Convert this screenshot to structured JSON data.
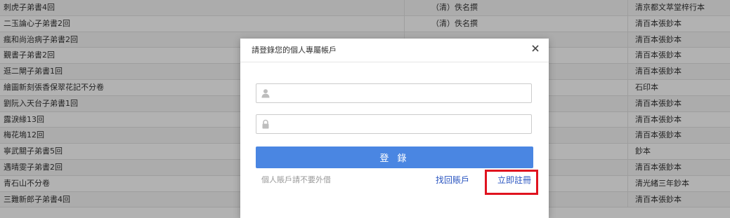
{
  "table": {
    "rows": [
      {
        "title": "刺虎子弟書4回",
        "author": "（清）佚名撰",
        "edition": "清京都文萃堂梓行本"
      },
      {
        "title": "二玉論心子弟書2回",
        "author": "（清）佚名撰",
        "edition": "清百本張鈔本"
      },
      {
        "title": "瘋和尚治病子弟書2回",
        "author": "",
        "edition": "清百本張鈔本"
      },
      {
        "title": "覲書子弟書2回",
        "author": "",
        "edition": "清百本張鈔本"
      },
      {
        "title": "逛二閘子弟書1回",
        "author": "",
        "edition": "清百本張鈔本"
      },
      {
        "title": "繪圖新刻張香保翠花記不分卷",
        "author": "",
        "edition": "石印本"
      },
      {
        "title": "劉阮入天台子弟書1回",
        "author": "",
        "edition": "清百本張鈔本"
      },
      {
        "title": "露淚緣13回",
        "author": "",
        "edition": "清百本張鈔本"
      },
      {
        "title": "梅花塢12回",
        "author": "",
        "edition": "清百本張鈔本"
      },
      {
        "title": "寧武關子弟書5回",
        "author": "",
        "edition": "鈔本"
      },
      {
        "title": "遇晴雯子弟書2回",
        "author": "",
        "edition": "清百本張鈔本"
      },
      {
        "title": "青石山不分卷",
        "author": "",
        "edition": "清光緒三年鈔本"
      },
      {
        "title": "三難新郎子弟書4回",
        "author": "",
        "edition": "清百本張鈔本"
      }
    ]
  },
  "modal": {
    "title": "請登錄您的個人專屬帳戶",
    "username_value": "",
    "password_value": "",
    "login_label": "登 錄",
    "note": "個人賬戶請不要外借",
    "forgot_label": "找回賬戶",
    "register_label": "立即註冊",
    "icons": {
      "close": "close-icon",
      "user": "user-icon",
      "lock": "lock-icon"
    }
  },
  "colors": {
    "login_button": "#4a86e2",
    "link": "#2a55c0",
    "highlight": "#e0131f"
  }
}
